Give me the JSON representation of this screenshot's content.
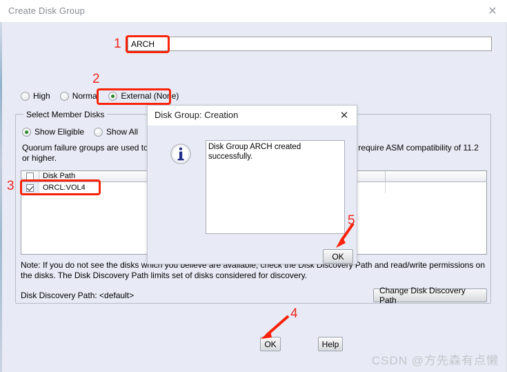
{
  "window": {
    "title": "Create Disk Group",
    "close_icon": "close-icon"
  },
  "disk_group": {
    "name_value": "ARCH",
    "name_placeholder": ""
  },
  "redundancy": {
    "options": [
      {
        "label": "High",
        "selected": false
      },
      {
        "label": "Normal",
        "selected": false
      },
      {
        "label": "External (None)",
        "selected": true
      }
    ]
  },
  "member_disks": {
    "legend": "Select Member Disks",
    "show_options": [
      {
        "label": "Show Eligible",
        "selected": true
      },
      {
        "label": "Show All",
        "selected": false
      }
    ],
    "quorum_text": "Quorum failure groups are used to store voting files and do not contain any user data. They require ASM compatibility of 11.2 or higher.",
    "table": {
      "columns": [
        "",
        "Disk Path",
        "",
        ""
      ],
      "header_checkbox_checked": false,
      "rows": [
        {
          "checked": true,
          "disk_path": "ORCL:VOL4",
          "col3": "",
          "col4": ""
        }
      ]
    },
    "note_text": "Note: If you do not see the disks which you believe are available, check the Disk Discovery Path and read/write permissions on the disks. The Disk Discovery Path limits set of disks considered for discovery.",
    "discovery_path_label": "Disk Discovery Path: <default>",
    "change_path_button": "Change Disk Discovery Path"
  },
  "footer": {
    "ok_label": "OK",
    "help_label": "Help"
  },
  "modal": {
    "title": "Disk Group: Creation",
    "close_icon": "close-icon",
    "icon": "info-icon",
    "message": "Disk Group ARCH created successfully.",
    "ok_label": "OK"
  },
  "annotations": {
    "markers": [
      "1",
      "2",
      "3",
      "4",
      "5"
    ],
    "color": "#fa2208"
  },
  "watermark": {
    "text": "CSDN @方先森有点懒"
  }
}
